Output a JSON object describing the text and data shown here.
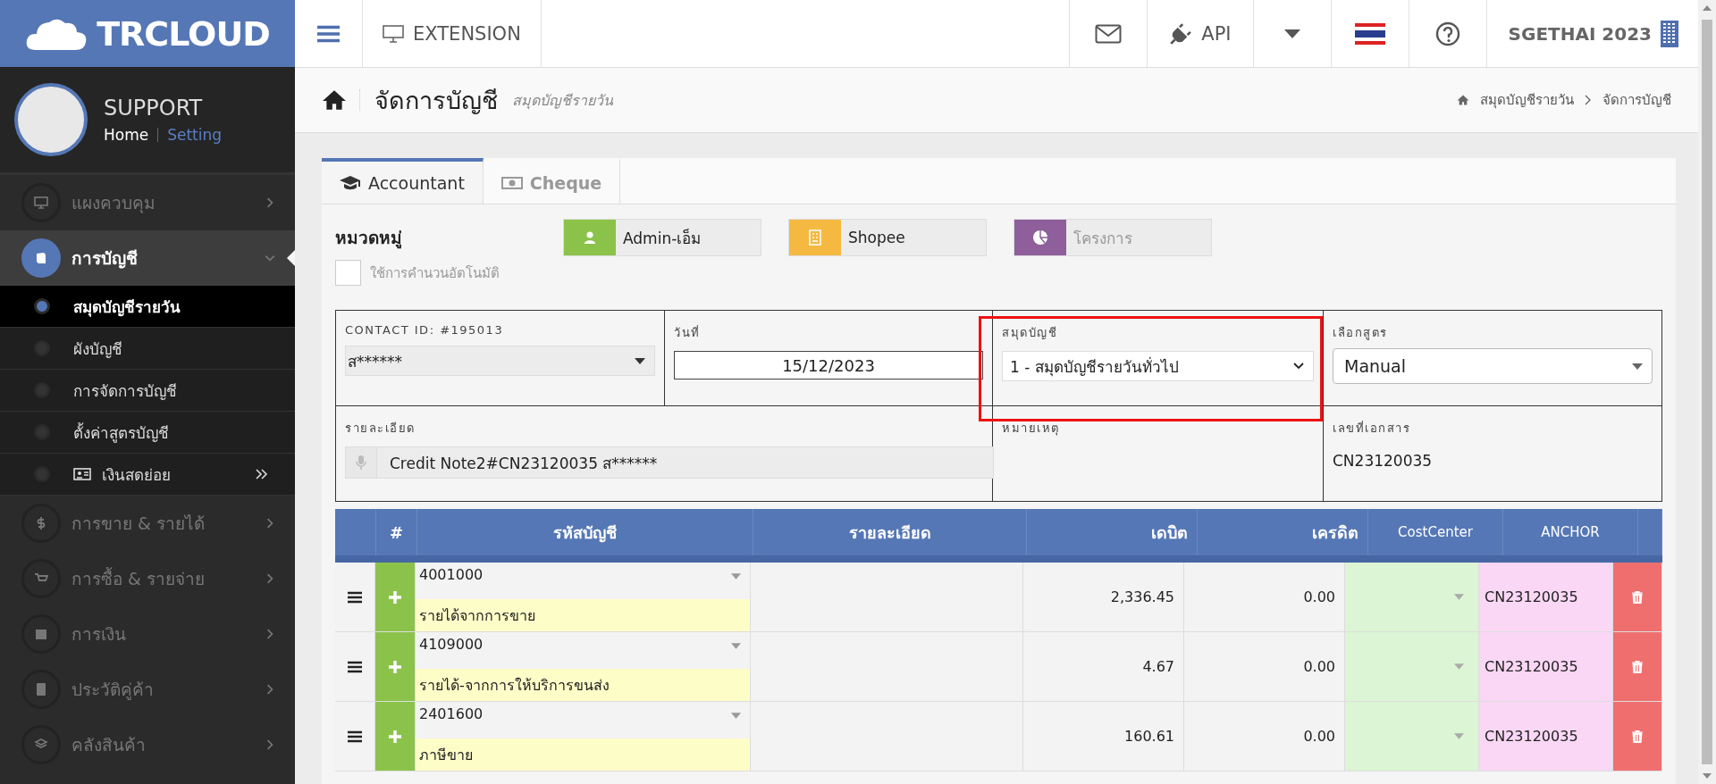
{
  "brand": {
    "logo": "TRCLOUD"
  },
  "topbar": {
    "extension": "EXTENSION",
    "api": "API",
    "company": "SGETHAI 2023"
  },
  "user": {
    "name": "SUPPORT",
    "home": "Home",
    "setting": "Setting"
  },
  "sidebar": {
    "items": [
      {
        "label": "แผงควบคุม",
        "selected": false,
        "expanded": false
      },
      {
        "label": "การบัญชี",
        "selected": true,
        "expanded": true,
        "children": [
          {
            "label": "สมุดบัญชีรายวัน",
            "selected": true,
            "submenu": false
          },
          {
            "label": "ผังบัญชี",
            "selected": false,
            "submenu": false
          },
          {
            "label": "การจัดการบัญชี",
            "selected": false,
            "submenu": false
          },
          {
            "label": "ตั้งค่าสูตรบัญชี",
            "selected": false,
            "submenu": false
          },
          {
            "label": "เงินสดย่อย",
            "selected": false,
            "submenu": true
          }
        ]
      },
      {
        "label": "การขาย & รายได้",
        "selected": false,
        "expanded": false
      },
      {
        "label": "การซื้อ & รายจ่าย",
        "selected": false,
        "expanded": false
      },
      {
        "label": "การเงิน",
        "selected": false,
        "expanded": false
      },
      {
        "label": "ประวัติคู่ค้า",
        "selected": false,
        "expanded": false
      },
      {
        "label": "คลังสินค้า",
        "selected": false,
        "expanded": false
      }
    ]
  },
  "page": {
    "title": "จัดการบัญชี",
    "subtitle": "สมุดบัญชีรายวัน",
    "breadcrumb": [
      "สมุดบัญชีรายวัน",
      "จัดการบัญชี"
    ]
  },
  "tabs": [
    {
      "label": "Accountant",
      "selected": true
    },
    {
      "label": "Cheque",
      "selected": false
    }
  ],
  "category": {
    "title": "หมวดหมู่",
    "auto_calc": {
      "label": "ใช้การคำนวนอัตโนมัติ",
      "checked": false
    },
    "buttons": [
      {
        "label": "Admin-เอ็ม",
        "color": "#8bc34a",
        "disabled": false
      },
      {
        "label": "Shopee",
        "color": "#f5b942",
        "disabled": false
      },
      {
        "label": "โครงการ",
        "color": "#8e5f9a",
        "disabled": true
      }
    ]
  },
  "form": {
    "contact": {
      "label": "CONTACT ID: #195013",
      "value": "ส******"
    },
    "date": {
      "label": "วันที่",
      "value": "15/12/2023"
    },
    "book": {
      "label": "สมุดบัญชี",
      "value": "1 - สมุดบัญชีรายวันทั่วไป",
      "highlighted": true
    },
    "formula": {
      "label": "เลือกสูตร",
      "value": "Manual"
    },
    "detail": {
      "label": "รายละเอียด",
      "value": "Credit Note2#CN23120035 ส******"
    },
    "note": {
      "label": "หมายเหตุ"
    },
    "doc_no": {
      "label": "เลขที่เอกสาร",
      "value": "CN23120035"
    }
  },
  "table": {
    "columns": [
      "#",
      "รหัสบัญชี",
      "รายละเอียด",
      "เดบิต",
      "เครดิต",
      "CostCenter",
      "ANCHOR"
    ],
    "rows": [
      {
        "code": "4001000",
        "name": "รายได้จากการขาย",
        "debit": "2,336.45",
        "credit": "0.00",
        "anchor": "CN23120035"
      },
      {
        "code": "4109000",
        "name": "รายได้-จากการให้บริการขนส่ง",
        "debit": "4.67",
        "credit": "0.00",
        "anchor": "CN23120035"
      },
      {
        "code": "2401600",
        "name": "ภาษีขาย",
        "debit": "160.61",
        "credit": "0.00",
        "anchor": "CN23120035"
      }
    ]
  }
}
